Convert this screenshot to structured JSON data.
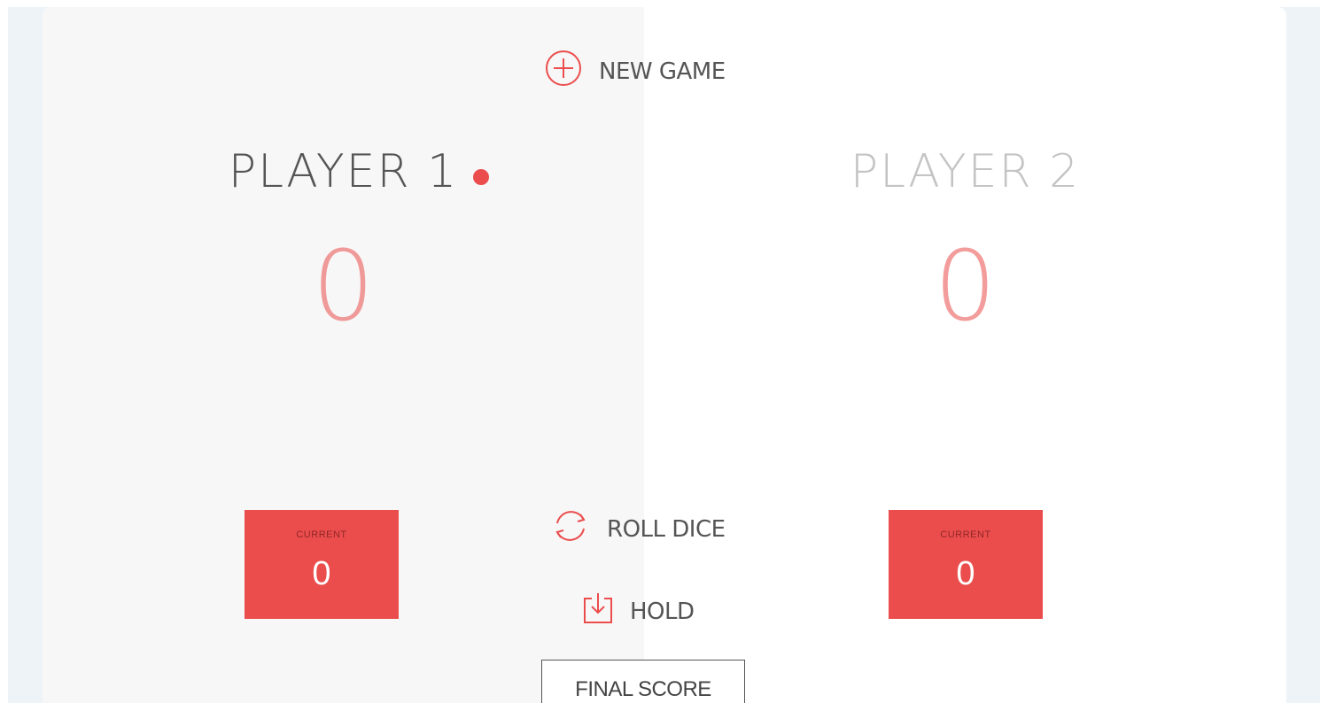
{
  "controls": {
    "new_game": "NEW GAME",
    "roll_dice": "ROLL DICE",
    "hold": "HOLD",
    "final_score": "FINAL SCORE"
  },
  "players": [
    {
      "name": "PLAYER 1",
      "score": "0",
      "current_label": "CURRENT",
      "current_score": "0",
      "active": true
    },
    {
      "name": "PLAYER 2",
      "score": "0",
      "current_label": "CURRENT",
      "current_score": "0",
      "active": false
    }
  ],
  "icons": {
    "new_game": "plus-circle-icon",
    "roll_dice": "refresh-icon",
    "hold": "download-icon",
    "active_indicator": "dot-icon"
  },
  "colors": {
    "accent": "#eb4d4d",
    "active_panel": "#f7f7f7",
    "inactive_panel": "#ffffff",
    "backdrop": "#eef3f7"
  }
}
